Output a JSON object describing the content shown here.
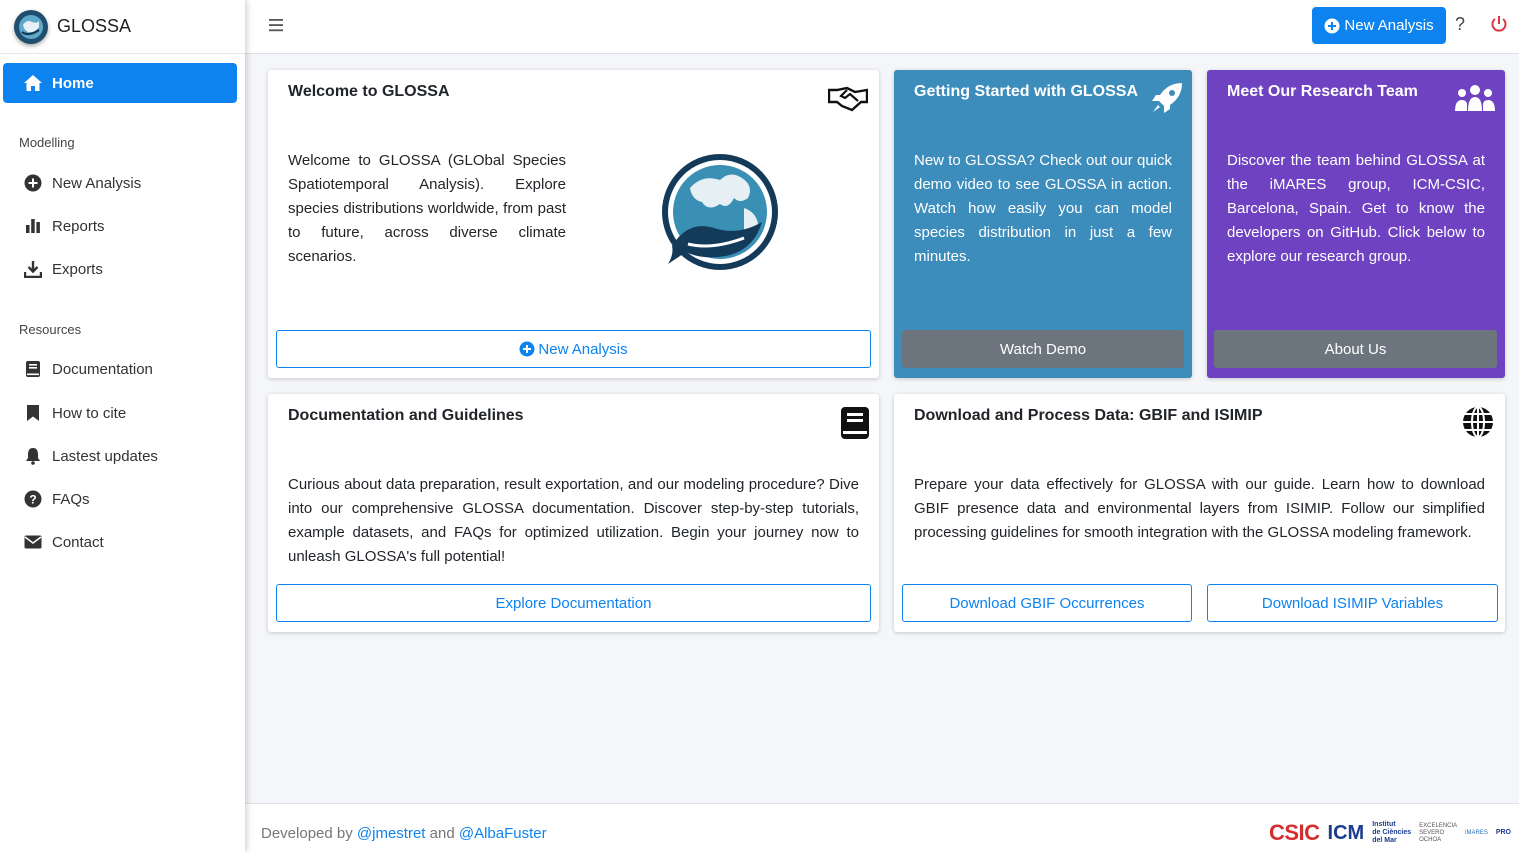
{
  "brand": {
    "name": "GLOSSA"
  },
  "sidebar": {
    "home_label": "Home",
    "sections": [
      {
        "header": "Modelling"
      },
      {
        "header": "Resources"
      }
    ],
    "items": [
      {
        "label": "New Analysis",
        "icon": "plus-circle-icon"
      },
      {
        "label": "Reports",
        "icon": "bar-chart-icon"
      },
      {
        "label": "Exports",
        "icon": "download-icon"
      },
      {
        "label": "Documentation",
        "icon": "book-icon"
      },
      {
        "label": "How to cite",
        "icon": "bookmark-icon"
      },
      {
        "label": "Lastest updates",
        "icon": "bell-icon"
      },
      {
        "label": "FAQs",
        "icon": "question-circle-icon"
      },
      {
        "label": "Contact",
        "icon": "envelope-icon"
      }
    ]
  },
  "topbar": {
    "new_analysis_label": "New Analysis",
    "help_label": "?"
  },
  "cards": {
    "welcome": {
      "title": "Welcome to GLOSSA",
      "text": "Welcome to GLOSSA (GLObal Species Spatiotemporal Analysis). Explore species distributions worldwide, from past to future, across diverse climate scenarios.",
      "button": "New Analysis"
    },
    "getting_started": {
      "title": "Getting Started with GLOSSA",
      "text": "New to GLOSSA? Check out our quick demo video to see GLOSSA in action. Watch how easily you can model species distribution in just a few minutes.",
      "button": "Watch Demo"
    },
    "team": {
      "title": "Meet Our Research Team",
      "text": "Discover the team behind GLOSSA at the iMARES group, ICM-CSIC, Barcelona, Spain. Get to know the developers on GitHub. Click below to explore our research group.",
      "button": "About Us"
    },
    "docs": {
      "title": "Documentation and Guidelines",
      "text": "Curious about data preparation, result exportation, and our modeling procedure? Dive into our comprehensive GLOSSA documentation. Discover step-by-step tutorials, example datasets, and FAQs for optimized utilization. Begin your journey now to unleash GLOSSA's full potential!",
      "button": "Explore Documentation"
    },
    "download": {
      "title": "Download and Process Data: GBIF and ISIMIP",
      "text": "Prepare your data effectively for GLOSSA with our guide. Learn how to download GBIF presence data and environmental layers from ISIMIP. Follow our simplified processing guidelines for smooth integration with the GLOSSA modeling framework.",
      "button_gbif": "Download GBIF Occurrences",
      "button_isimip": "Download ISIMIP Variables"
    }
  },
  "footer": {
    "prefix": "Developed by",
    "author1": "@jmestret",
    "conjunction": "and",
    "author2": "@AlbaFuster",
    "logos": {
      "csic": "CSIC",
      "icm": "ICM",
      "icm_text": [
        "Institut",
        "de Ciències",
        "del Mar"
      ],
      "excelencia": [
        "EXCELENCIA",
        "SEVERO",
        "OCHOA"
      ],
      "imares": "iMARES",
      "pro": "PRO"
    }
  },
  "colors": {
    "primary": "#0d83f0",
    "card_blue": "#3c8dbc",
    "card_purple": "#6f42c1",
    "button_gray": "#6c757d",
    "power_red": "#dc3545"
  }
}
